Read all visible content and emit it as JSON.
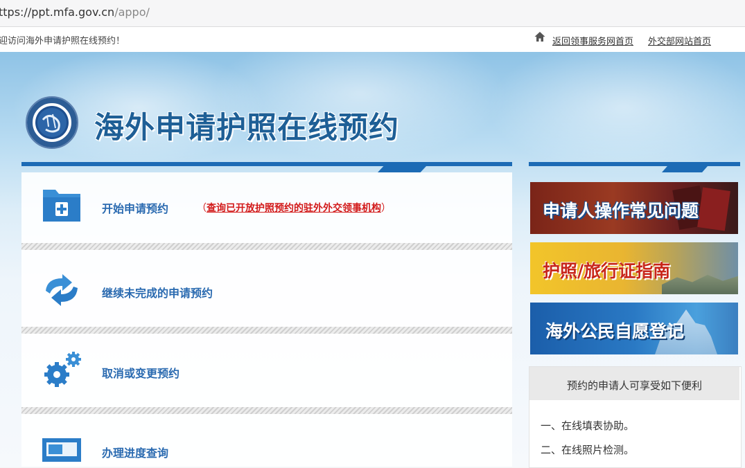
{
  "browser": {
    "url_host": "ttps://ppt.mfa.gov.cn",
    "url_path": "/appo/"
  },
  "top_strip": {
    "welcome": "迎访问海外申请护照在线预约！",
    "links": [
      "返回领事服务网首页",
      "外交部网站首页"
    ]
  },
  "header": {
    "title": "海外申请护照在线预约"
  },
  "main": {
    "items": [
      {
        "label": "开始申请预约",
        "icon": "folder-plus-icon"
      },
      {
        "label": "继续未完成的申请预约",
        "icon": "refresh-arrows-icon"
      },
      {
        "label": "取消或变更预约",
        "icon": "gears-icon"
      },
      {
        "label": "办理进度查询",
        "icon": "monitor-icon"
      }
    ],
    "query_link": {
      "open_paren": "（",
      "text": "查询已开放护照预约的驻外外交领事机构",
      "close_paren": "）"
    }
  },
  "sidebar": {
    "banners": [
      "申请人操作常见问题",
      "护照/旅行证指南",
      "海外公民自愿登记"
    ],
    "benefits": {
      "title": "预约的申请人可享受如下便利",
      "items": [
        "一、在线填表协助。",
        "二、在线照片检测。"
      ]
    }
  },
  "colors": {
    "brand_blue": "#1c6bb5",
    "link_blue": "#2a6ab0",
    "alert_red": "#d21a1a"
  }
}
